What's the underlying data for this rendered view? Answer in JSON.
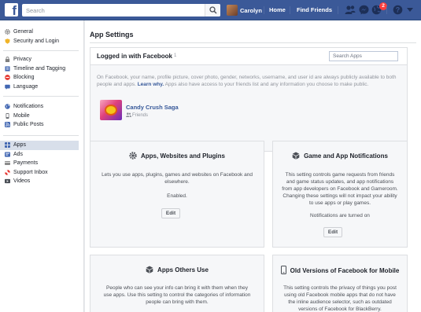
{
  "topbar": {
    "search_placeholder": "Search",
    "user_name": "Carolyn",
    "home": "Home",
    "find_friends": "Find Friends",
    "notification_count": "2",
    "brand_color": "#3b5998"
  },
  "sidebar": {
    "groups": [
      [
        {
          "label": "General",
          "icon": "gear-icon",
          "color": "#7f7f7f"
        },
        {
          "label": "Security and Login",
          "icon": "badge-icon",
          "color": "#f0b429"
        }
      ],
      [
        {
          "label": "Privacy",
          "icon": "lock-icon",
          "color": "#7f7f7f"
        },
        {
          "label": "Timeline and Tagging",
          "icon": "timeline-icon",
          "color": "#4267b2"
        },
        {
          "label": "Blocking",
          "icon": "blocking-icon",
          "color": "#e4322b"
        },
        {
          "label": "Language",
          "icon": "language-icon",
          "color": "#4267b2"
        }
      ],
      [
        {
          "label": "Notifications",
          "icon": "globe-icon",
          "color": "#4267b2"
        },
        {
          "label": "Mobile",
          "icon": "mobile-icon",
          "color": "#4b4f56"
        },
        {
          "label": "Public Posts",
          "icon": "rss-icon",
          "color": "#4267b2"
        }
      ],
      [
        {
          "label": "Apps",
          "icon": "apps-icon",
          "color": "#4267b2",
          "active": true
        },
        {
          "label": "Ads",
          "icon": "ads-icon",
          "color": "#4267b2"
        },
        {
          "label": "Payments",
          "icon": "card-icon",
          "color": "#7f7f7f"
        },
        {
          "label": "Support Inbox",
          "icon": "lifebuoy-icon",
          "color": "#e4322b"
        },
        {
          "label": "Videos",
          "icon": "video-icon",
          "color": "#4b4f56"
        }
      ]
    ]
  },
  "main": {
    "title": "App Settings",
    "login": {
      "title": "Logged in with Facebook",
      "count": "1",
      "search_placeholder": "Search Apps",
      "description": "On Facebook, your name, profile picture, cover photo, gender, networks, username, and user id are always publicly available to both people and apps.",
      "learn_why": "Learn why.",
      "description_tail": "Apps also have access to your friends list and any information you choose to make public.",
      "app_name": "Candy Crush Saga",
      "app_audience": "Friends"
    },
    "cards": {
      "apps_websites": {
        "title": "Apps, Websites and Plugins",
        "body": "Lets you use apps, plugins, games and websites on Facebook and elsewhere.",
        "status": "Enabled.",
        "edit": "Edit"
      },
      "game_notifications": {
        "title": "Game and App Notifications",
        "body": "This setting controls game requests from friends and game status updates, and app notifications from app developers on Facebook and Gameroom. Changing these settings will not impact your ability to use apps or play games.",
        "status": "Notifications are turned on",
        "edit": "Edit"
      },
      "apps_others_use": {
        "title": "Apps Others Use",
        "body": "People who can see your info can bring it with them when they use apps. Use this setting to control the categories of information people can bring with them."
      },
      "old_versions": {
        "title": "Old Versions of Facebook for Mobile",
        "body": "This setting controls the privacy of things you post using old Facebook mobile apps that do not have the inline audience selector, such as outdated versions of Facebook for BlackBerry."
      }
    }
  }
}
